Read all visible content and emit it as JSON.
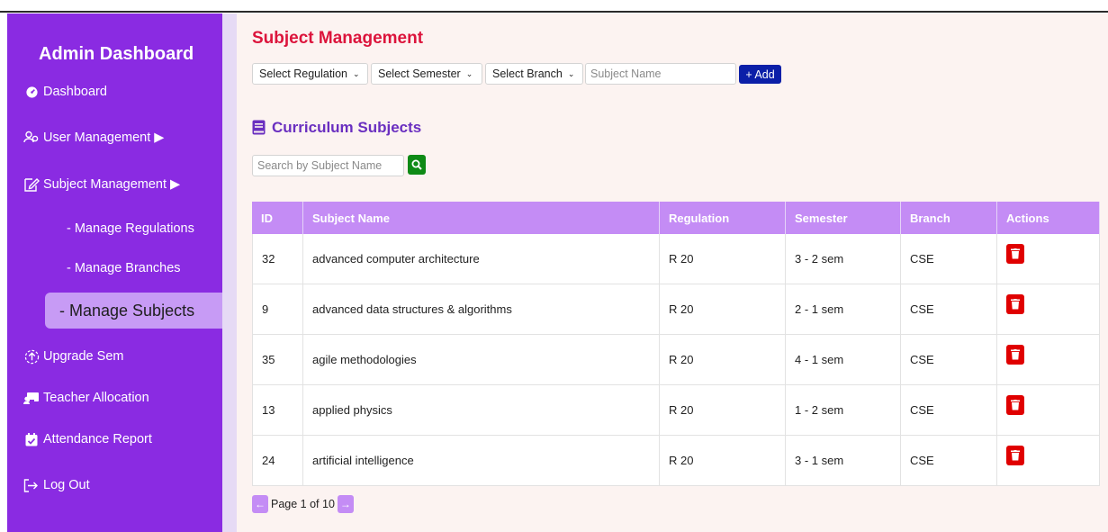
{
  "sidebar": {
    "title": "Admin Dashboard",
    "items": {
      "dashboard": "Dashboard",
      "user_management": "User Management ▶",
      "subject_management": "Subject Management ▶",
      "upgrade_sem": "Upgrade Sem",
      "teacher_allocation": "Teacher Allocation",
      "attendance_report": "Attendance Report",
      "log_out": "Log Out"
    },
    "sub_items": {
      "manage_regulations": "- Manage Regulations",
      "manage_branches": "- Manage Branches",
      "manage_subjects": "- Manage Subjects"
    },
    "active_item": "manage_subjects"
  },
  "header": {
    "title": "Subject Management"
  },
  "filters": {
    "regulation": "Select Regulation",
    "semester": "Select Semester",
    "branch": "Select Branch",
    "subject_name_placeholder": "Subject Name",
    "add_label": "+ Add"
  },
  "section": {
    "title": "Curriculum Subjects",
    "search_placeholder": "Search by Subject Name"
  },
  "table": {
    "columns": {
      "id": "ID",
      "name": "Subject Name",
      "regulation": "Regulation",
      "semester": "Semester",
      "branch": "Branch",
      "actions": "Actions"
    },
    "rows": [
      {
        "id": "32",
        "name": "advanced computer architecture",
        "regulation": "R 20",
        "semester": "3 - 2 sem",
        "branch": "CSE"
      },
      {
        "id": "9",
        "name": "advanced data structures & algorithms",
        "regulation": "R 20",
        "semester": "2 - 1 sem",
        "branch": "CSE"
      },
      {
        "id": "35",
        "name": "agile methodologies",
        "regulation": "R 20",
        "semester": "4 - 1 sem",
        "branch": "CSE"
      },
      {
        "id": "13",
        "name": "applied physics",
        "regulation": "R 20",
        "semester": "1 - 2 sem",
        "branch": "CSE"
      },
      {
        "id": "24",
        "name": "artificial intelligence",
        "regulation": "R 20",
        "semester": "3 - 1 sem",
        "branch": "CSE"
      }
    ]
  },
  "pagination": {
    "label": "Page 1 of 10"
  },
  "colors": {
    "sidebar": "#8a2be2",
    "active_item": "#c79bf5",
    "page_title": "#dc143c",
    "section_title": "#6a2fc0",
    "table_header": "#c48cf5",
    "add_button": "#0b1fa8",
    "search_button": "#0e8a16",
    "delete_button": "#e00000"
  }
}
